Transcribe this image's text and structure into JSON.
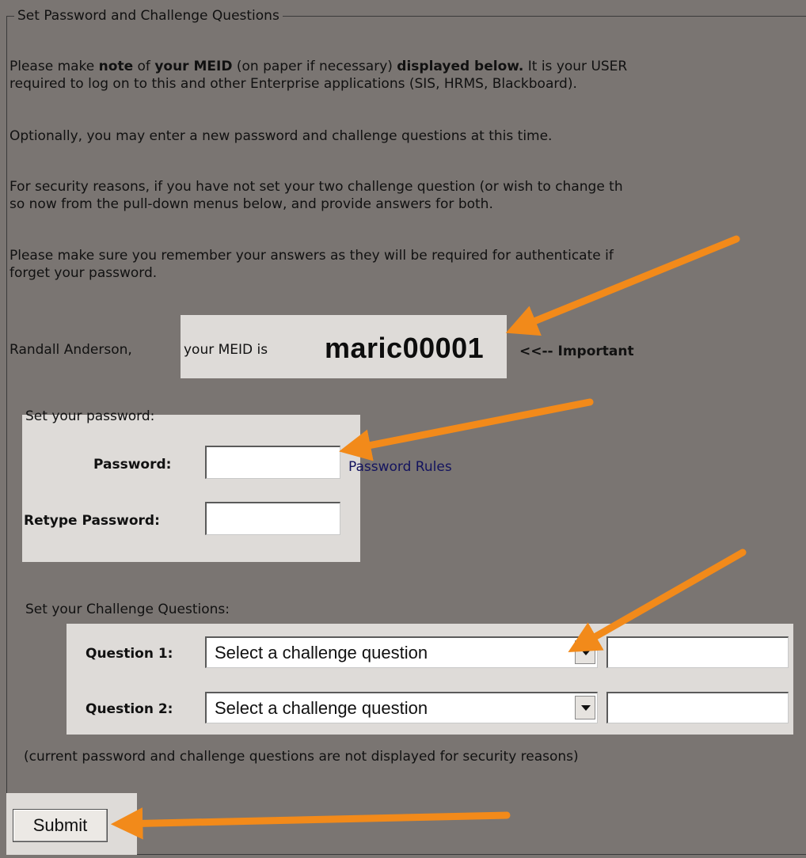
{
  "fieldset": {
    "legend": "Set Password and Challenge Questions"
  },
  "intro": {
    "line1_a": "Please make ",
    "line1_b": "note",
    "line1_c": " of ",
    "line1_d": "your MEID",
    "line1_e": " (on paper if necessary) ",
    "line1_f": "displayed below.",
    "line1_g": " It is your USER",
    "line2": "required to log on to this and other Enterprise applications (SIS, HRMS, Blackboard).",
    "optional": "Optionally, you may enter a new password and challenge questions at this time.",
    "security1": "For security reasons, if you have not set your two challenge question (or wish to change th",
    "security2": "so now from the pull-down menus below, and provide answers for both.",
    "remember1": "Please make sure you remember your answers as they will be required for authenticate if",
    "remember2": "forget your password."
  },
  "meid": {
    "name": "Randall Anderson,",
    "prefix": "your MEID is",
    "value": "maric00001",
    "important": "<<-- Important"
  },
  "password": {
    "heading": "Set your password:",
    "password_label": "Password:",
    "retype_label": "Retype Password:",
    "password_value": "",
    "retype_value": "",
    "rules_link": "Password Rules"
  },
  "challenge": {
    "heading": "Set your Challenge Questions:",
    "q1_label": "Question 1:",
    "q2_label": "Question 2:",
    "q1_selected": "Select a challenge question",
    "q2_selected": "Select a challenge question",
    "a1_value": "",
    "a2_value": ""
  },
  "note": "(current password and challenge questions are not displayed for security reasons)",
  "submit_label": "Submit",
  "colors": {
    "background": "#7a7572",
    "highlight_box": "#dedbd8",
    "arrow": "#f28a1a",
    "link": "#13135e"
  }
}
